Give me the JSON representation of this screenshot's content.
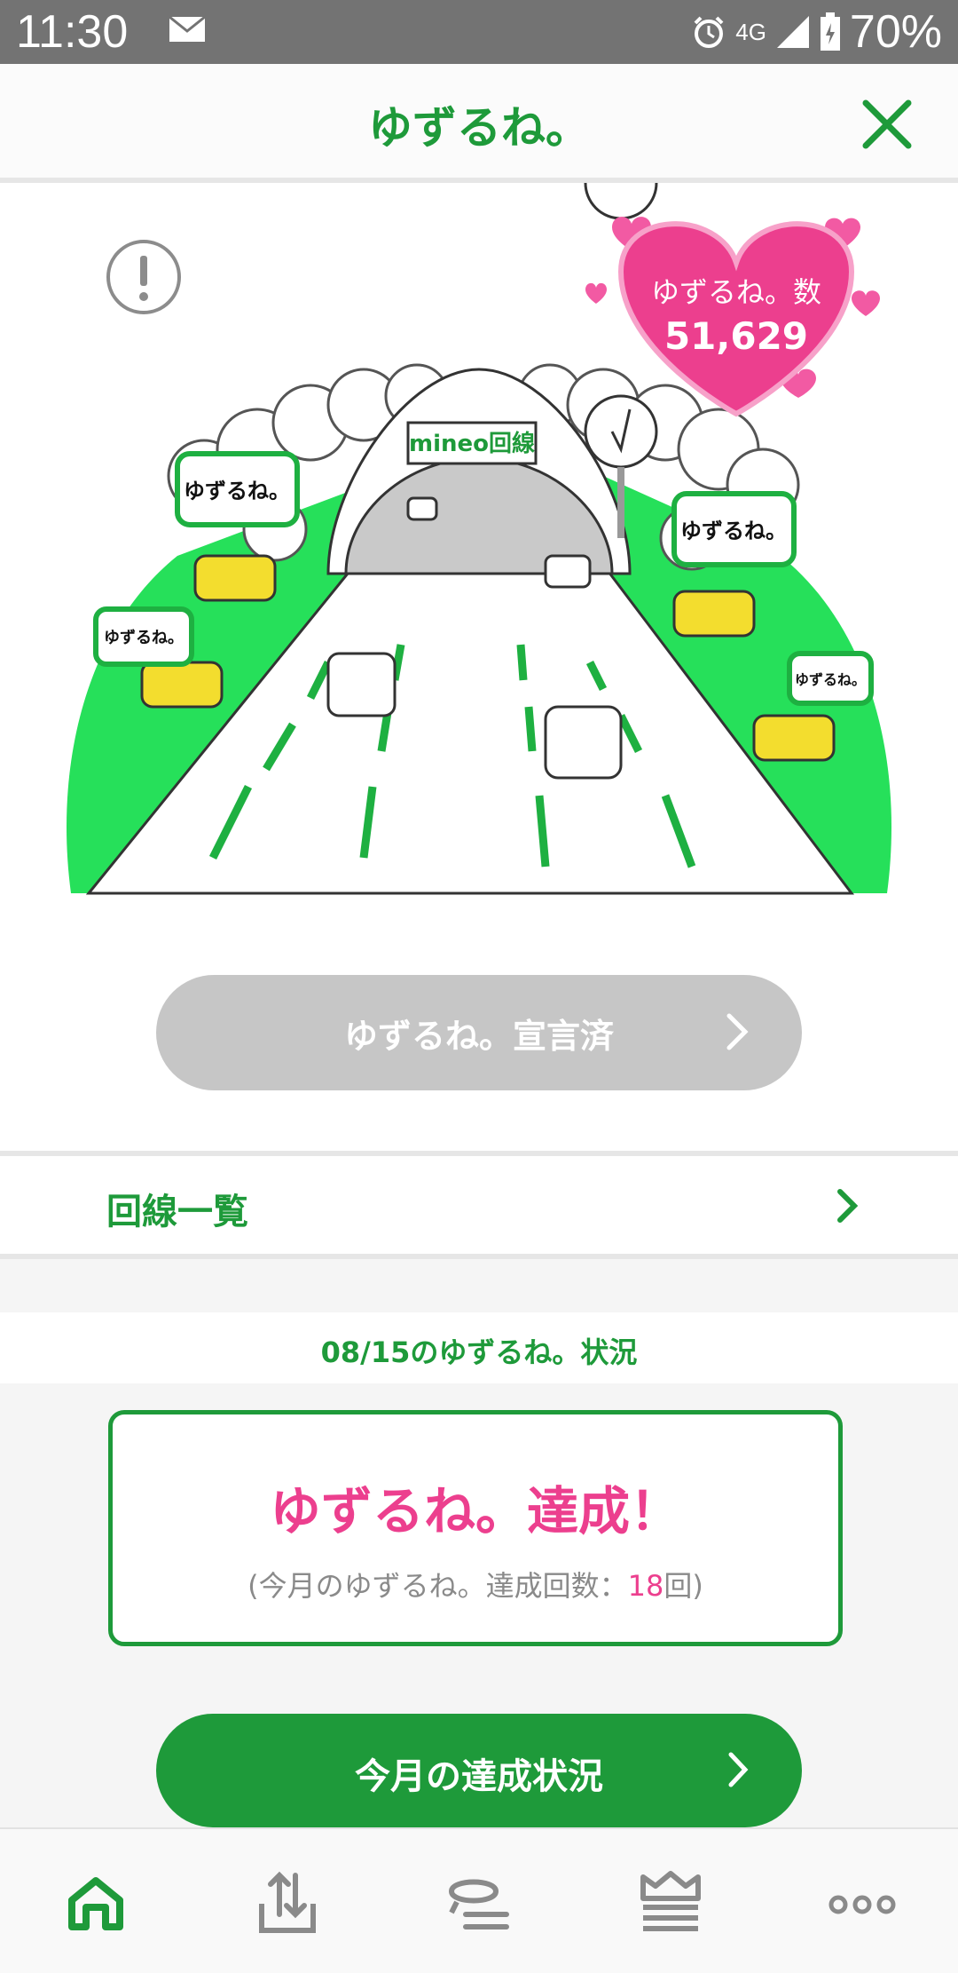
{
  "status_bar": {
    "time": "11:30",
    "network": "4G",
    "battery": "70%",
    "icons": [
      "mail-icon",
      "alarm-icon",
      "signal-icon",
      "battery-icon"
    ]
  },
  "app_bar": {
    "title": "ゆずるね。",
    "close_icon": "close-icon"
  },
  "hero": {
    "info_icon": "exclamation-icon",
    "illustration_sign": "mineo回線",
    "bubble_text": "ゆずるね。",
    "counter_label": "ゆずるね。数",
    "counter_value": "51,629",
    "declared_button_label": "ゆずるね。宣言済"
  },
  "line_list": {
    "label": "回線一覧"
  },
  "status_section": {
    "date_title": "08/15のゆずるね。状況",
    "result_title": "ゆずるね。達成！",
    "result_prefix": "(今月のゆずるね。達成回数：",
    "result_count": "18",
    "result_suffix": "回)",
    "monthly_button_label": "今月の達成状況"
  },
  "bottom_nav": {
    "items": [
      {
        "icon": "home-icon",
        "active": true
      },
      {
        "icon": "share-tray-icon",
        "active": false
      },
      {
        "icon": "chat-icon",
        "active": false
      },
      {
        "icon": "crown-icon",
        "active": false
      },
      {
        "icon": "more-icon",
        "active": false
      }
    ]
  },
  "colors": {
    "brand_green": "#1e9a3a",
    "accent_pink": "#ec3f8e",
    "grass_green": "#26e05a",
    "disabled_gray": "#c6c6c6"
  }
}
